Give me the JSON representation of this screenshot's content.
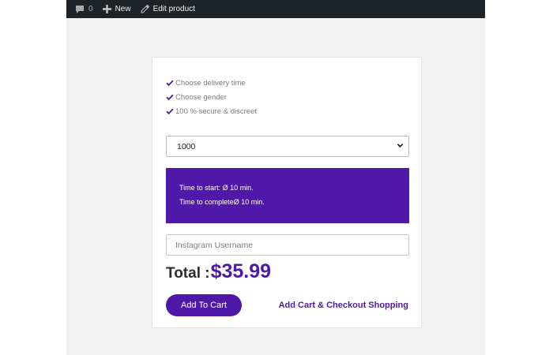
{
  "colors": {
    "accent": "#4f18a8",
    "admin_bar": "#1d2327",
    "page_background": "#f1f1f1"
  },
  "admin_bar": {
    "comments": {
      "icon": "comment-bubble-icon",
      "count": "0"
    },
    "new": {
      "icon": "plus-icon",
      "label": "New"
    },
    "edit": {
      "icon": "pencil-icon",
      "label": "Edit product"
    }
  },
  "product": {
    "features": [
      {
        "icon": "checkmark-icon",
        "label": "Choose delivery time"
      },
      {
        "icon": "checkmark-icon",
        "label": "Choose gender"
      },
      {
        "icon": "checkmark-icon",
        "label": "100 % secure & discreet"
      }
    ],
    "quantity_select": {
      "selected": "1000",
      "icon": "chevron-down-icon"
    },
    "info": {
      "time_to_start": "Time to start: Ø 10 min.",
      "time_to_complete": "Time to completeØ 10 min."
    },
    "username_input": {
      "placeholder": "Instagram Username",
      "value": ""
    },
    "total": {
      "label": "Total :",
      "price": "$35.99"
    },
    "add_to_cart_label": "Add To Cart",
    "checkout_link_label": "Add Cart & Checkout Shopping"
  }
}
